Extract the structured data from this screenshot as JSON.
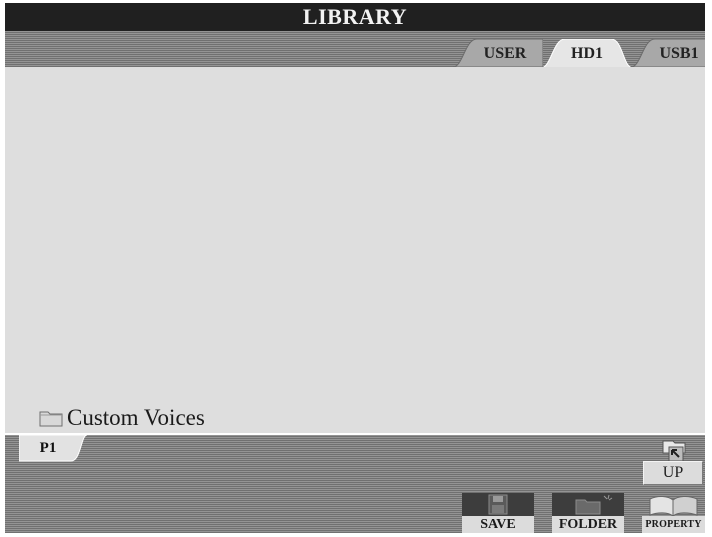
{
  "window": {
    "title": "LIBRARY"
  },
  "tabs": [
    {
      "label": "USER",
      "active": false
    },
    {
      "label": "HD1",
      "active": true
    },
    {
      "label": "USB1",
      "active": false
    }
  ],
  "files": [
    {
      "name": "Custom Voices",
      "type": "folder",
      "icon": "folder-icon"
    }
  ],
  "pagination": {
    "current_page": "P1"
  },
  "buttons": {
    "up": {
      "label": "UP",
      "icon": "folder-up-icon"
    },
    "save": {
      "label": "SAVE",
      "icon": "floppy-disk-icon"
    },
    "folder": {
      "label": "FOLDER",
      "icon": "new-folder-icon"
    },
    "property": {
      "label": "PROPERTY",
      "icon": "open-book-icon"
    }
  },
  "colors": {
    "title_bar": "#202020",
    "title_text": "#f2f2f2",
    "file_area": "#dedede",
    "tab_active": "#e6e6e6",
    "tab_inactive": "#a8a8a8",
    "button_face": "#dcdcdc",
    "button_icon_bg": "#3d3d3d"
  }
}
